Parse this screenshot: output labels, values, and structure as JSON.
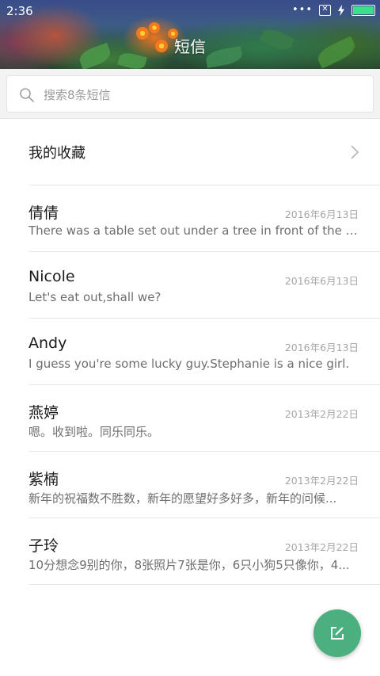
{
  "status_bar": {
    "time": "2:36",
    "battery_color": "#3ce08a"
  },
  "header": {
    "title": "短信"
  },
  "search": {
    "placeholder": "搜索8条短信"
  },
  "favorites": {
    "label": "我的收藏"
  },
  "conversations": [
    {
      "name": "倩倩",
      "date": "2016年6月13日",
      "preview": "There was a table set out under a tree in front of the ho..."
    },
    {
      "name": "Nicole",
      "date": "2016年6月13日",
      "preview": "Let's eat out,shall we?"
    },
    {
      "name": "Andy",
      "date": "2016年6月13日",
      "preview": "I guess you're some lucky guy.Stephanie is a nice girl."
    },
    {
      "name": "燕婷",
      "date": "2013年2月22日",
      "preview": "嗯。收到啦。同乐同乐。"
    },
    {
      "name": "紫楠",
      "date": "2013年2月22日",
      "preview": "新年的祝福数不胜数，新年的愿望好多好多，新年的问候..."
    },
    {
      "name": "子玲",
      "date": "2013年2月22日",
      "preview": "10分想念9别的你，8张照片7张是你，6只小狗5只像你，4..."
    }
  ],
  "fab": {
    "icon": "compose-icon",
    "color": "#4caf7f"
  }
}
